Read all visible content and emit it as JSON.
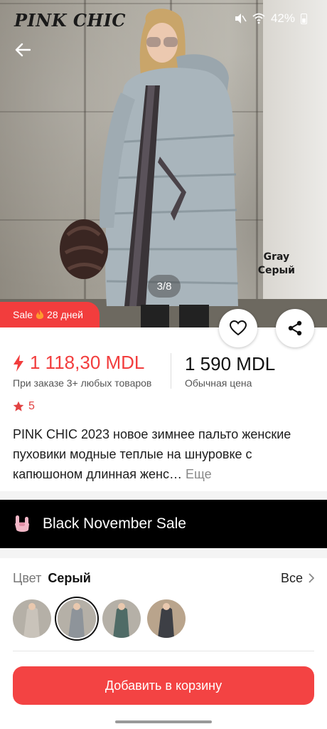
{
  "status_bar": {
    "brand": "PINK CHIC",
    "battery": "42%"
  },
  "gallery": {
    "page_indicator": "3/8",
    "variant_caption_en": "Gray",
    "variant_caption_ru": "Серый"
  },
  "sale_badge": {
    "label": "Sale",
    "days": "28 дней"
  },
  "price": {
    "promo_price": "1 118,30 MDL",
    "promo_note": "При заказе 3+ любых товаров",
    "regular_price": "1 590 MDL",
    "regular_note": "Обычная цена"
  },
  "rating": {
    "value": "5"
  },
  "product": {
    "title": "PINK CHIC 2023 новое зимнее пальто женские пуховики модные теплые на шнуровке с капюшоном длинная женс…",
    "more_label": "Еще"
  },
  "promo_banner": {
    "label": "Black November Sale"
  },
  "color": {
    "label": "Цвет",
    "selected_value": "Серый",
    "see_all_label": "Все"
  },
  "swatches": [
    {
      "name": "light-beige",
      "color": "#c9c3ba",
      "selected": false
    },
    {
      "name": "gray",
      "color": "#8e949a",
      "selected": true
    },
    {
      "name": "teal-green",
      "color": "#4f6b66",
      "selected": false
    },
    {
      "name": "dark-graphite",
      "color": "#3d3f45",
      "selected": false
    }
  ],
  "cart": {
    "add_button_label": "Добавить в корзину"
  },
  "colors": {
    "accent": "#f23d3d",
    "banner_bg": "#000000"
  }
}
